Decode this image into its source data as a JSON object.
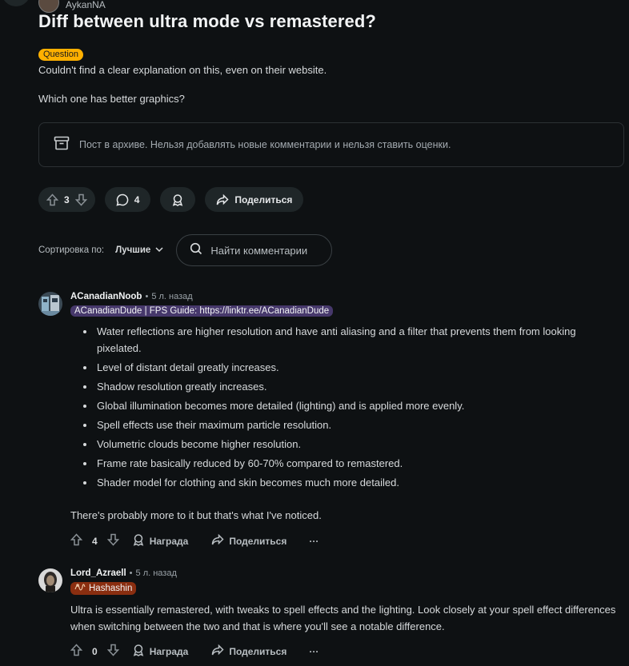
{
  "post": {
    "author": "AykanNA",
    "title": "Diff between ultra mode vs remastered?",
    "flair": "Question",
    "body": [
      "Couldn't find a clear explanation on this, even on their website.",
      "Which one has better graphics?"
    ],
    "archived_notice": "Пост в архиве. Нельзя добавлять новые комментарии и нельзя ставить оценки.",
    "votes": "3",
    "comments": "4",
    "share_label": "Поделиться"
  },
  "sort": {
    "label": "Сортировка по:",
    "value": "Лучшие",
    "search_placeholder": "Найти комментарии"
  },
  "comments": [
    {
      "author": "ACanadianNoob",
      "time": "5 л. назад",
      "flair": "ACanadianDude | FPS Guide: https://linktr.ee/ACanadianDude",
      "flair_color": "#46386b",
      "bullets": [
        "Water reflections are higher resolution and have anti aliasing and a filter that prevents them from looking pixelated.",
        "Level of distant detail greatly increases.",
        "Shadow resolution greatly increases.",
        "Global illumination becomes more detailed (lighting) and is applied more evenly.",
        "Spell effects use their maximum particle resolution.",
        "Volumetric clouds become higher resolution.",
        "Frame rate basically reduced by 60-70% compared to remastered.",
        "Shader model for clothing and skin becomes much more detailed."
      ],
      "closing": "There's probably more to it but that's what I've noticed.",
      "votes": "4",
      "award_label": "Награда",
      "share_label": "Поделиться",
      "more_label": "···"
    },
    {
      "author": "Lord_Azraell",
      "time": "5 л. назад",
      "flair": "Hashashin",
      "flair_color": "#8a2e10",
      "text": "Ultra is essentially remastered, with tweaks to spell effects and the lighting. Look closely at your spell effect differences when switching between the two and that is where you'll see a notable difference.",
      "votes": "0",
      "award_label": "Награда",
      "share_label": "Поделиться",
      "more_label": "···"
    }
  ],
  "colors": {
    "background": "#0e1113",
    "pill": "#1f2628",
    "question_flair": "#ffb000"
  }
}
